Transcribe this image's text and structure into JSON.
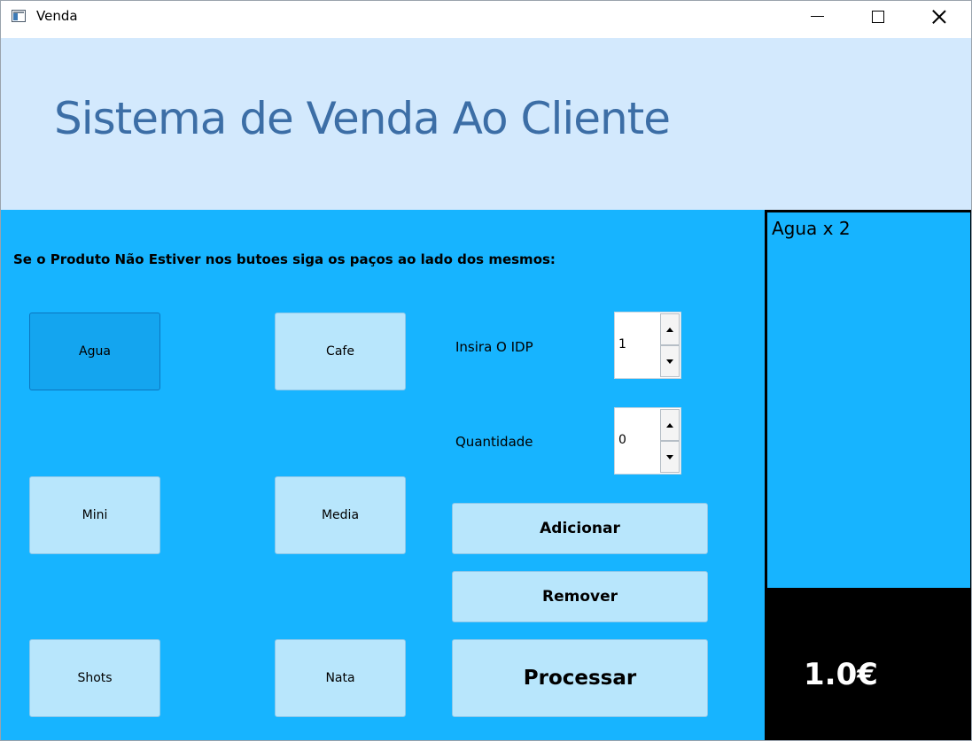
{
  "window": {
    "title": "Venda"
  },
  "header": {
    "title": "Sistema de Venda Ao Cliente"
  },
  "main": {
    "instruction": "Se o Produto Não Estiver nos butoes siga os paços ao lado dos mesmos:",
    "products": [
      {
        "label": "Agua"
      },
      {
        "label": "Cafe"
      },
      {
        "label": "Mini"
      },
      {
        "label": "Media"
      },
      {
        "label": "Shots"
      },
      {
        "label": "Nata"
      }
    ],
    "idp": {
      "label": "Insira O IDP",
      "value": "1"
    },
    "quantity": {
      "label": "Quantidade",
      "value": "0"
    },
    "buttons": {
      "add": "Adicionar",
      "remove": "Remover",
      "process": "Processar"
    }
  },
  "cart": {
    "items": [
      "Agua x 2"
    ],
    "total": "1.0€"
  },
  "colors": {
    "header_bg": "#d3e9fd",
    "title_color": "#3c6ea6",
    "main_bg": "#17b4ff",
    "button_bg": "#b8e6fc",
    "selected_button_bg": "#14a5ef",
    "total_bg": "#000000",
    "total_text": "#ffffff"
  }
}
